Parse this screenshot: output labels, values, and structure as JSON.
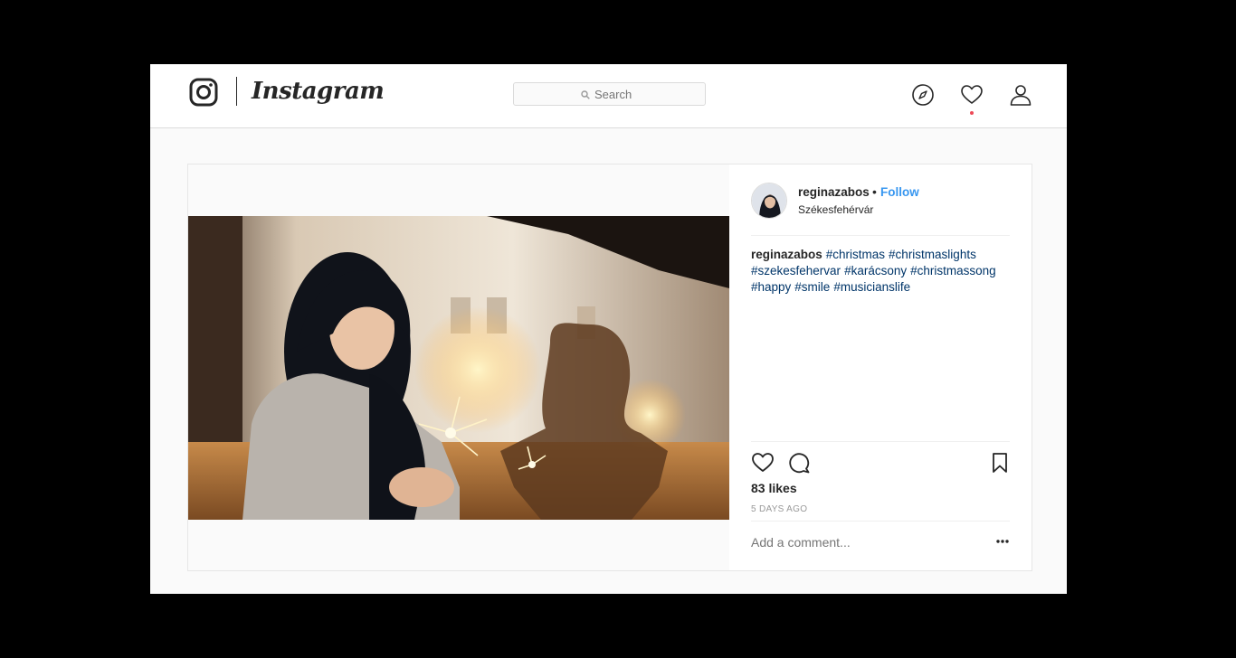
{
  "header": {
    "wordmark": "Instagram",
    "search_placeholder": "Search"
  },
  "nav": {
    "icons": [
      "explore-compass-icon",
      "activity-heart-icon",
      "profile-user-icon"
    ],
    "notification_color": "#ed4956"
  },
  "post": {
    "username": "reginazabos",
    "separator": "•",
    "follow_label": "Follow",
    "location": "Székesfehérvár",
    "caption": {
      "username": "reginazabos",
      "hashtags": [
        "#christmas",
        "#christmaslights",
        "#szekesfehervar",
        "#karácsony",
        "#christmassong",
        "#happy",
        "#smile",
        "#musicianslife"
      ]
    },
    "likes": "83 likes",
    "timestamp": "5 DAYS AGO",
    "comment_placeholder": "Add a comment...",
    "colors": {
      "link": "#3897f0",
      "hashtag": "#003569"
    }
  }
}
